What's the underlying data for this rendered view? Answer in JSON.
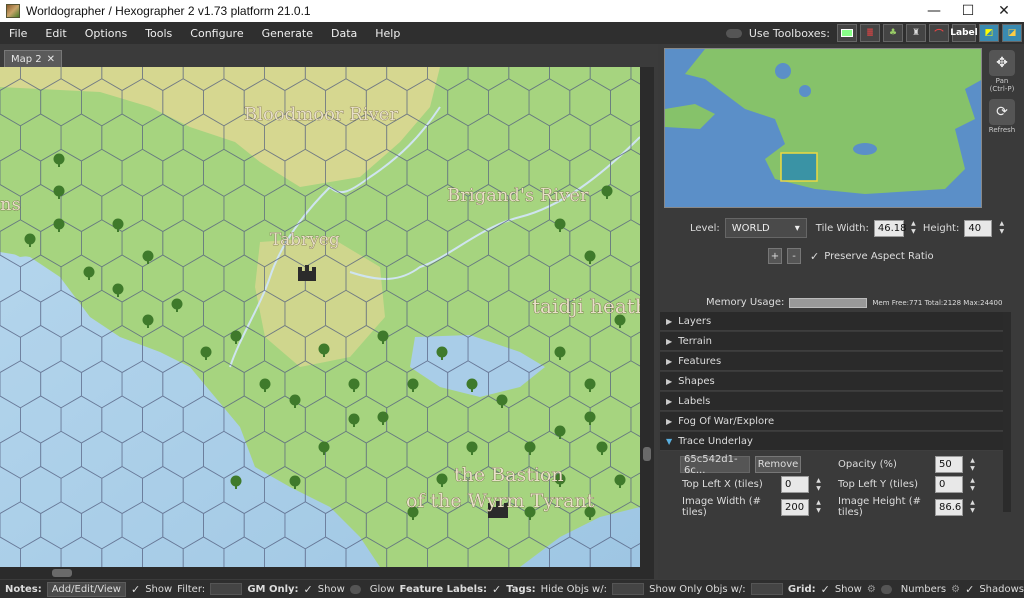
{
  "titlebar": {
    "title": "Worldographer / Hexographer 2 v1.73 platform 21.0.1",
    "minimize": "—",
    "maximize": "☐",
    "close": "✕"
  },
  "menu": [
    "File",
    "Edit",
    "Options",
    "Tools",
    "Configure",
    "Generate",
    "Data",
    "Help"
  ],
  "toolboxes": {
    "label": "Use Toolboxes:",
    "label_icon_text": "Label"
  },
  "map": {
    "tab_label": "Map 2",
    "tab_close": "✕",
    "labels": {
      "bloodmoor": "Bloodmoor River",
      "brigand": "Brigand's River",
      "tabryeg": "Tabryeg",
      "taidji": "taidji heath",
      "ns": "ns",
      "bastion1": "the Bastion",
      "bastion2": "of the Wyrm Tyrant"
    }
  },
  "nav": {
    "pan_label": "Pan",
    "pan_shortcut": "(Ctrl-P)",
    "refresh_label": "Refresh"
  },
  "level": {
    "label": "Level:",
    "value": "WORLD",
    "tile_width_label": "Tile Width:",
    "tile_width": "46.18",
    "height_label": "Height:",
    "height": "40"
  },
  "aspect": {
    "plus": "+",
    "minus": "-",
    "label": "Preserve Aspect Ratio"
  },
  "memory": {
    "label": "Memory Usage:",
    "stats": "Mem Free:771 Total:2128 Max:24400"
  },
  "sections": [
    "Layers",
    "Terrain",
    "Features",
    "Shapes",
    "Labels",
    "Fog Of War/Explore",
    "Trace Underlay"
  ],
  "trace": {
    "file": "65c542d1-6c...",
    "remove": "Remove",
    "opacity_label": "Opacity (%)",
    "opacity": "50",
    "top_left_x_label": "Top Left X (tiles)",
    "top_left_x": "0",
    "top_left_y_label": "Top Left Y (tiles)",
    "top_left_y": "0",
    "image_width_label": "Image Width (# tiles)",
    "image_width": "200",
    "image_height_label": "Image Height (# tiles)",
    "image_height": "86.6"
  },
  "status": {
    "notes": "Notes:",
    "add_edit_view": "Add/Edit/View",
    "show": "Show",
    "filter": "Filter:",
    "gm_only": "GM Only:",
    "gm_show": "Show",
    "glow": "Glow",
    "feature_labels": "Feature Labels:",
    "tags": "Tags:",
    "hide_objs": "Hide Objs w/:",
    "show_only_objs": "Show Only Objs w/:",
    "grid": "Grid:",
    "grid_show": "Show",
    "numbers": "Numbers",
    "shadows": "Shadows"
  },
  "colors": {
    "water": "#a9cde8",
    "grass": "#9fd07a",
    "hill": "#d8d58e",
    "hexline": "#556080"
  }
}
